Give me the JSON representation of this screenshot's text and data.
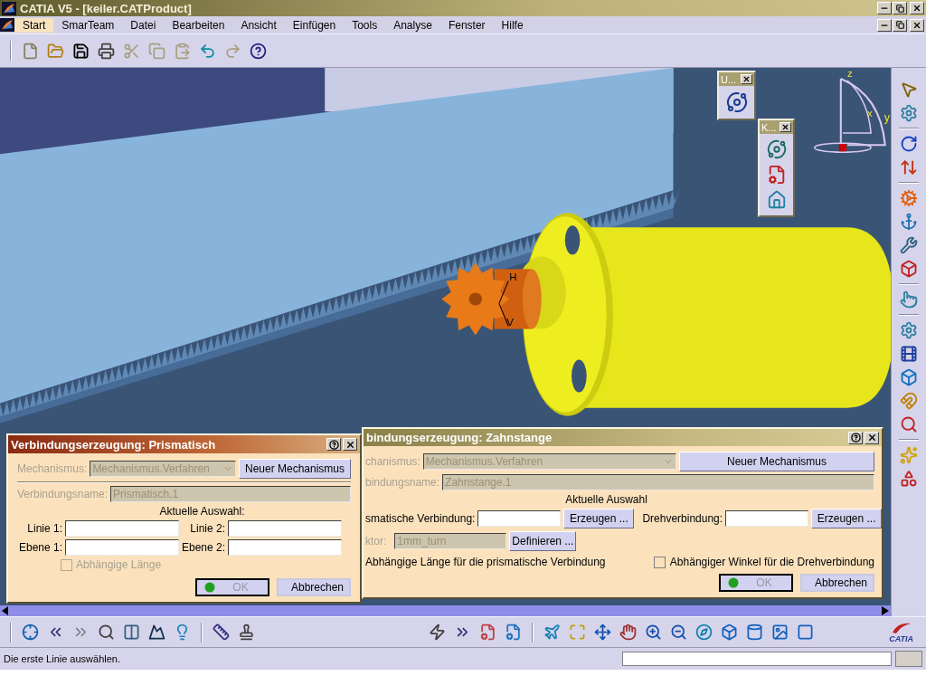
{
  "window": {
    "title": "CATIA V5 - [keiler.CATProduct]"
  },
  "menu": [
    {
      "label": "Start",
      "selected": true
    },
    {
      "label": "SmarTeam",
      "selected": false
    },
    {
      "label": "Datei",
      "selected": false
    },
    {
      "label": "Bearbeiten",
      "selected": false
    },
    {
      "label": "Ansicht",
      "selected": false
    },
    {
      "label": "Einfügen",
      "selected": false
    },
    {
      "label": "Tools",
      "selected": false
    },
    {
      "label": "Analyse",
      "selected": false
    },
    {
      "label": "Fenster",
      "selected": false
    },
    {
      "label": "Hilfe",
      "selected": false
    }
  ],
  "compass": {
    "labels": [
      "z",
      "x",
      "y"
    ]
  },
  "scene": {
    "markers": [
      "H",
      "V"
    ]
  },
  "floating_toolbars": [
    {
      "title": "U..."
    },
    {
      "title": "K..."
    }
  ],
  "prismatic_dialog": {
    "title": "Verbindungserzeugung: Prismatisch",
    "active": true,
    "mechanism": {
      "label": "Mechanismus:",
      "value": "Mechanismus.Verfahren",
      "disabled": true,
      "button": "Neuer Mechanismus"
    },
    "name": {
      "label": "Verbindungsname:",
      "value": "Prismatisch.1",
      "disabled": true
    },
    "heading": "Aktuelle Auswahl:",
    "selection_fields": [
      {
        "label": "Linie 1:"
      },
      {
        "label": "Linie 2:"
      },
      {
        "label": "Ebene 1:"
      },
      {
        "label": "Ebene 2:"
      }
    ],
    "checkbox": {
      "label": "Abhängige Länge",
      "checked": false,
      "disabled": true
    },
    "buttons": [
      {
        "label": "OK",
        "kind": "ok",
        "disabled": true
      },
      {
        "label": "Abbrechen",
        "kind": "cancel",
        "disabled": false
      }
    ]
  },
  "rack_dialog": {
    "title": "bindungserzeugung: Zahnstange",
    "active": false,
    "mechanism": {
      "label": "chanismus:",
      "value": "Mechanismus.Verfahren",
      "disabled": true,
      "button": "Neuer Mechanismus"
    },
    "name": {
      "label": "bindungsname:",
      "value": "Zahnstange.1",
      "disabled": true
    },
    "heading": "Aktuelle Auswahl",
    "joints": [
      {
        "label": "smatische Verbindung:",
        "button": "Erzeugen ..."
      },
      {
        "label": "Drehverbindung:",
        "button": "Erzeugen ..."
      }
    ],
    "factor": {
      "label": "ktor:",
      "value": "1mm_turn",
      "disabled": true,
      "button": "Definieren ..."
    },
    "options": [
      {
        "kind": "text",
        "label": "Abhängige Länge für die prismatische Verbindung"
      },
      {
        "kind": "checkbox",
        "label": "Abhängiger Winkel für die Drehverbindung",
        "checked": false
      }
    ],
    "buttons": [
      {
        "label": "OK",
        "kind": "ok",
        "disabled": true
      },
      {
        "label": "Abbrechen",
        "kind": "cancel",
        "disabled": false
      }
    ]
  },
  "brand_logo": "CATIA",
  "status_bar": {
    "message": "Die erste Linie auswählen."
  }
}
